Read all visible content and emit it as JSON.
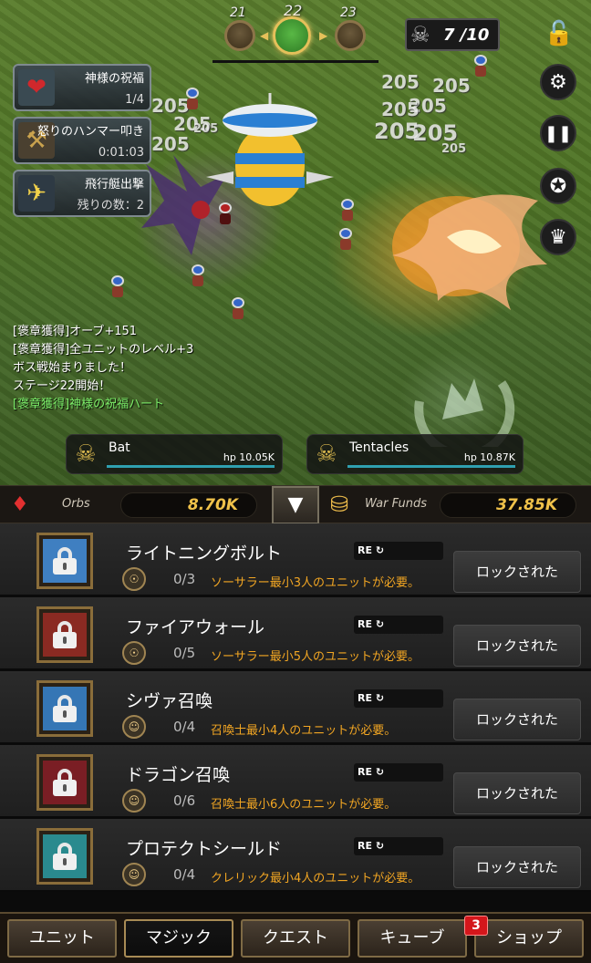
{
  "stage": {
    "prev": "21",
    "current": "22",
    "next": "23"
  },
  "kill_counter": "7 /10",
  "side_buttons": [
    "settings-icon",
    "pause-icon",
    "achievement-icon",
    "crown-icon"
  ],
  "buffs": [
    {
      "title": "神様の祝福",
      "sub": "1/4",
      "icon": "heart-icon"
    },
    {
      "title": "怒りのハンマー叩き",
      "sub": "0:01:03",
      "icon": "hammer-icon"
    },
    {
      "title": "飛行艇出撃",
      "sub": "残りの数：2",
      "icon": "airship-icon"
    }
  ],
  "damage_numbers": [
    "205",
    "205",
    "205",
    "205",
    "205",
    "205",
    "205",
    "205",
    "205",
    "205",
    "205"
  ],
  "log": [
    {
      "text": "[褒章獲得]オーブ+151",
      "color": "white"
    },
    {
      "text": "[褒章獲得]全ユニットのレベル+3",
      "color": "white"
    },
    {
      "text": "ボス戦始まりました！",
      "color": "white"
    },
    {
      "text": "ステージ22開始！",
      "color": "white"
    },
    {
      "text": "[褒章獲得]神様の祝福ハート",
      "color": "green"
    }
  ],
  "bosses": [
    {
      "name": "Bat",
      "hp": "hp 10.05K",
      "hp_fraction": 1.0
    },
    {
      "name": "Tentacles",
      "hp": "hp 10.87K",
      "hp_fraction": 1.0
    }
  ],
  "resources": {
    "orbs_label": "Orbs",
    "orbs_value": "8.70K",
    "funds_label": "War Funds",
    "funds_value": "37.85K",
    "toggle": "▼"
  },
  "spells": [
    {
      "name": "ライトニングボルト",
      "progress": "0/3",
      "requirement": "ソーサラー最小3人のユニットが必要。",
      "button": "ロックされた",
      "re": "RE",
      "frame_color": "#3f7fc1"
    },
    {
      "name": "ファイアウォール",
      "progress": "0/5",
      "requirement": "ソーサラー最小5人のユニットが必要。",
      "button": "ロックされた",
      "re": "RE",
      "frame_color": "#8a2a22"
    },
    {
      "name": "シヴァ召喚",
      "progress": "0/4",
      "requirement": "召喚士最小4人のユニットが必要。",
      "button": "ロックされた",
      "re": "RE",
      "frame_color": "#3576b5"
    },
    {
      "name": "ドラゴン召喚",
      "progress": "0/6",
      "requirement": "召喚士最小6人のユニットが必要。",
      "button": "ロックされた",
      "re": "RE",
      "frame_color": "#7a1e24"
    },
    {
      "name": "プロテクトシールド",
      "progress": "0/4",
      "requirement": "クレリック最小4人のユニットが必要。",
      "button": "ロックされた",
      "re": "RE",
      "frame_color": "#2a8a8e"
    }
  ],
  "tabs": [
    {
      "label": "ユニット",
      "active": false
    },
    {
      "label": "マジック",
      "active": true
    },
    {
      "label": "クエスト",
      "active": false
    },
    {
      "label": "キューブ",
      "active": false
    },
    {
      "label": "ショップ",
      "active": false
    }
  ],
  "shop_badge": "3"
}
